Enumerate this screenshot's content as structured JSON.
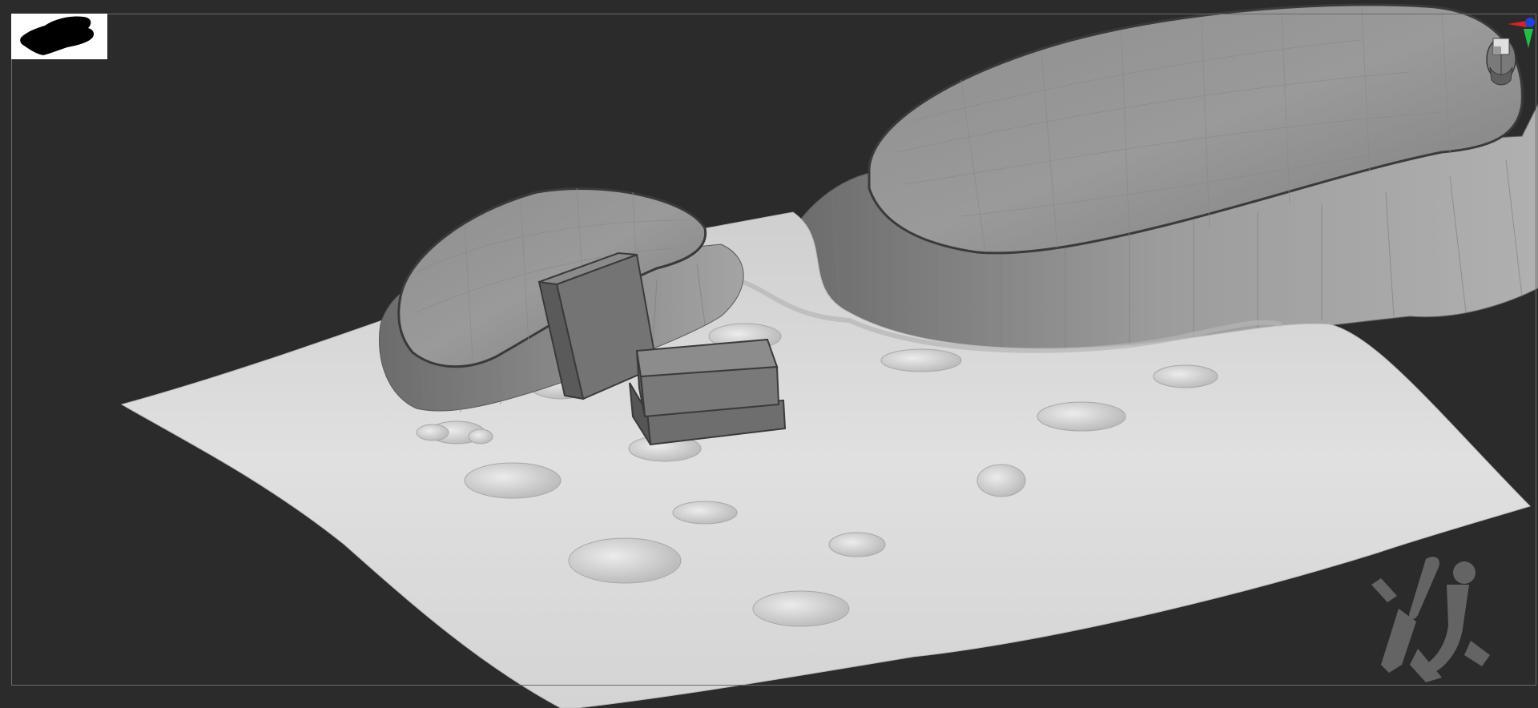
{
  "app": {
    "viewport": {
      "background_color": "#2b2b2b",
      "frame_border_color": "#6b6b6b"
    },
    "thumbnail": {
      "background_color": "#ffffff",
      "silhouette_color": "#000000",
      "icon": "model-silhouette-icon"
    },
    "navigation": {
      "view_cube_icon": "head-view-cube-icon",
      "axis_gizmo_icon": "xyz-axis-gizmo-icon",
      "axis_colors": {
        "x": "#e02020",
        "y": "#20c040",
        "z": "#2040e0"
      }
    },
    "watermark": {
      "icon": "artist-monogram-icon",
      "color": "#6e6e6e"
    },
    "scene": {
      "ground_color": "#d9d9d9",
      "rock_color": "#8c8c8c",
      "block_color": "#6f6f6f"
    }
  }
}
